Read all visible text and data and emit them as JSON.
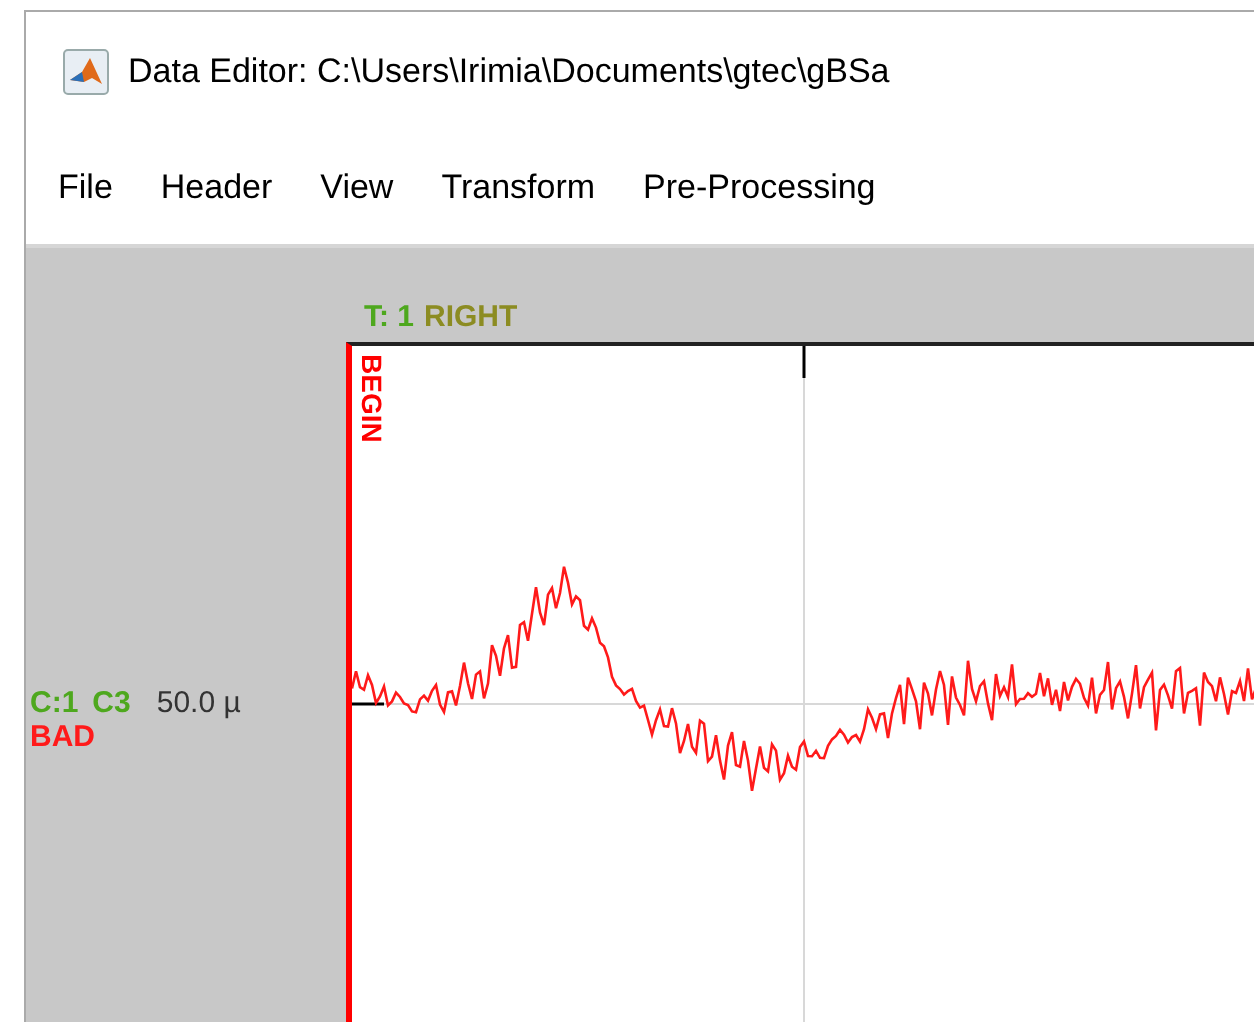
{
  "window": {
    "title": "Data Editor: C:\\Users\\Irimia\\Documents\\gtec\\gBSa"
  },
  "menu": [
    {
      "label": "File"
    },
    {
      "label": "Header"
    },
    {
      "label": "View"
    },
    {
      "label": "Transform"
    },
    {
      "label": "Pre-Processing"
    }
  ],
  "trial": {
    "number": "T: 1",
    "class": "RIGHT"
  },
  "begin_marker": {
    "label": "BEGIN"
  },
  "channel": {
    "index": "C:1",
    "name": "C3",
    "scale": "50.0 µ",
    "flag": "BAD"
  }
}
